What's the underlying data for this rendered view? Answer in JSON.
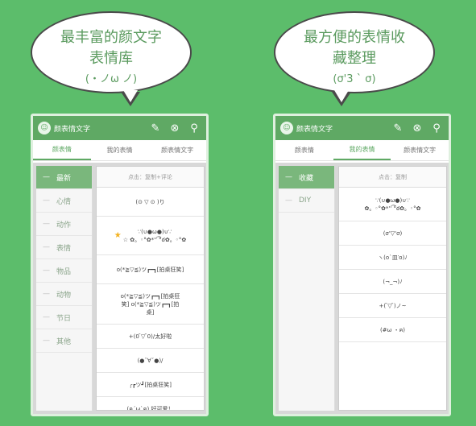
{
  "left_bubble": {
    "line1": "最丰富的颜文字",
    "line2": "表情库",
    "line3": "(・ノω ノ)"
  },
  "right_bubble": {
    "line1": "最方便的表情收",
    "line2": "藏整理",
    "line3": "(σ'3 ˋ σ)"
  },
  "left_app": {
    "title": "颜表情文字",
    "tabs": [
      "颜表情",
      "我的表情",
      "颜表情文字"
    ],
    "active_tab": 0,
    "sidebar": [
      "最新",
      "心情",
      "动作",
      "表情",
      "物品",
      "动物",
      "节日",
      "其他"
    ],
    "active_sidebar": 0,
    "list_header": "点击：复制+评论",
    "items": [
      "(⊙ ▽ ⊙ )り",
      "∵(∪●ω●)∪∵\n☆ ✿。◦°✿*'' ͡°ఠ✿。◦°✿",
      "o(*≧▽≦)ツ┏━┓[拍桌狂笑]",
      "o(*≧▽≦)ツ┏━┓[拍桌狂\n笑] o(*≧▽≦)ツ┏━┓[拍\n桌]",
      "+(0 ̄▽ ̄0)/太好啦",
      "(●ˇ∀ˇ●)/",
      "╭┏ツ┛[拍桌狂笑]",
      "(ฅ´ω`ฅ) 好可爱！"
    ]
  },
  "right_app": {
    "title": "颜表情文字",
    "tabs": [
      "颜表情",
      "我的表情",
      "颜表情文字"
    ],
    "active_tab": 1,
    "sidebar": [
      "收藏",
      "DIY"
    ],
    "active_sidebar": 0,
    "list_header": "点击：复制",
    "items": [
      "∵(∪●ω●)∪∵\n✿。◦°✿*'' ͡°ఠ✿。◦°✿",
      "(σ'▽'σ)",
      "ヽ(o`皿′o)ﾉ",
      "(¬_¬)ﾉ",
      "+(  ̄▽ ̄)ノ~",
      "(#ω ・ฅ)"
    ]
  },
  "colors": {
    "background": "#5cbd6b",
    "app_green": "#5fa964",
    "bubble_text": "#5a9a5e"
  },
  "icons": {
    "edit": "edit-icon",
    "close": "close-circle-icon",
    "search": "search-icon"
  }
}
